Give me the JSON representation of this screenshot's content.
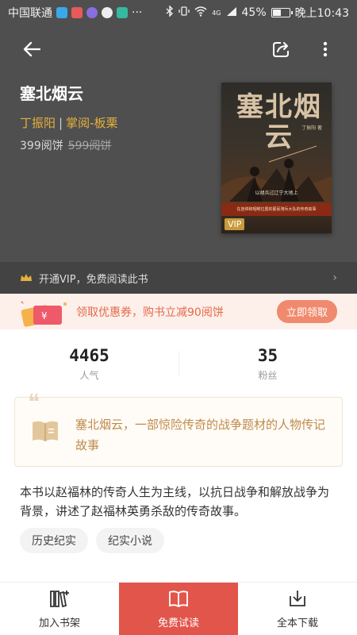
{
  "status_bar": {
    "carrier": "中国联通",
    "signal_label": "4G",
    "battery_percent": "45%",
    "battery_level": 0.45,
    "time": "晚上10:43"
  },
  "nav": {
    "back_icon": "arrow-left-icon",
    "share_icon": "share-icon",
    "more_icon": "more-vertical-icon"
  },
  "book": {
    "title": "塞北烟云",
    "author": "丁振阳",
    "publisher": "掌阅-板栗",
    "price": "399阅饼",
    "original_price": "599阅饼",
    "cover_title": "塞北烟云",
    "cover_author": "丁振阳 著",
    "cover_tagline": "以胡兵过辽宁大地上",
    "cover_subtitle": "在连绵和咽喉位置的蒙民骑兵大队的传奇故事",
    "vip_badge": "VIP"
  },
  "vip_bar": {
    "text": "开通VIP，免费阅读此书",
    "arrow": "›"
  },
  "coupon": {
    "text": "领取优惠券，购书立减90阅饼",
    "button": "立即领取"
  },
  "stats": [
    {
      "value": "4465",
      "label": "人气"
    },
    {
      "value": "35",
      "label": "粉丝"
    }
  ],
  "quote": {
    "mark": "❝",
    "text": "塞北烟云，一部惊险传奇的战争题材的人物传记故事"
  },
  "description": "本书以赵福林的传奇人生为主线，以抗日战争和解放战争为背景，讲述了赵福林英勇杀敌的传奇故事。",
  "tags": [
    "历史纪实",
    "纪实小说"
  ],
  "bottom_bar": {
    "shelf": "加入书架",
    "read": "免费试读",
    "download": "全本下载"
  },
  "colors": {
    "header_bg": "#4f4f4f",
    "accent_gold": "#e6b13c",
    "primary_red": "#e2554b",
    "coupon_red": "#e46a4b"
  }
}
